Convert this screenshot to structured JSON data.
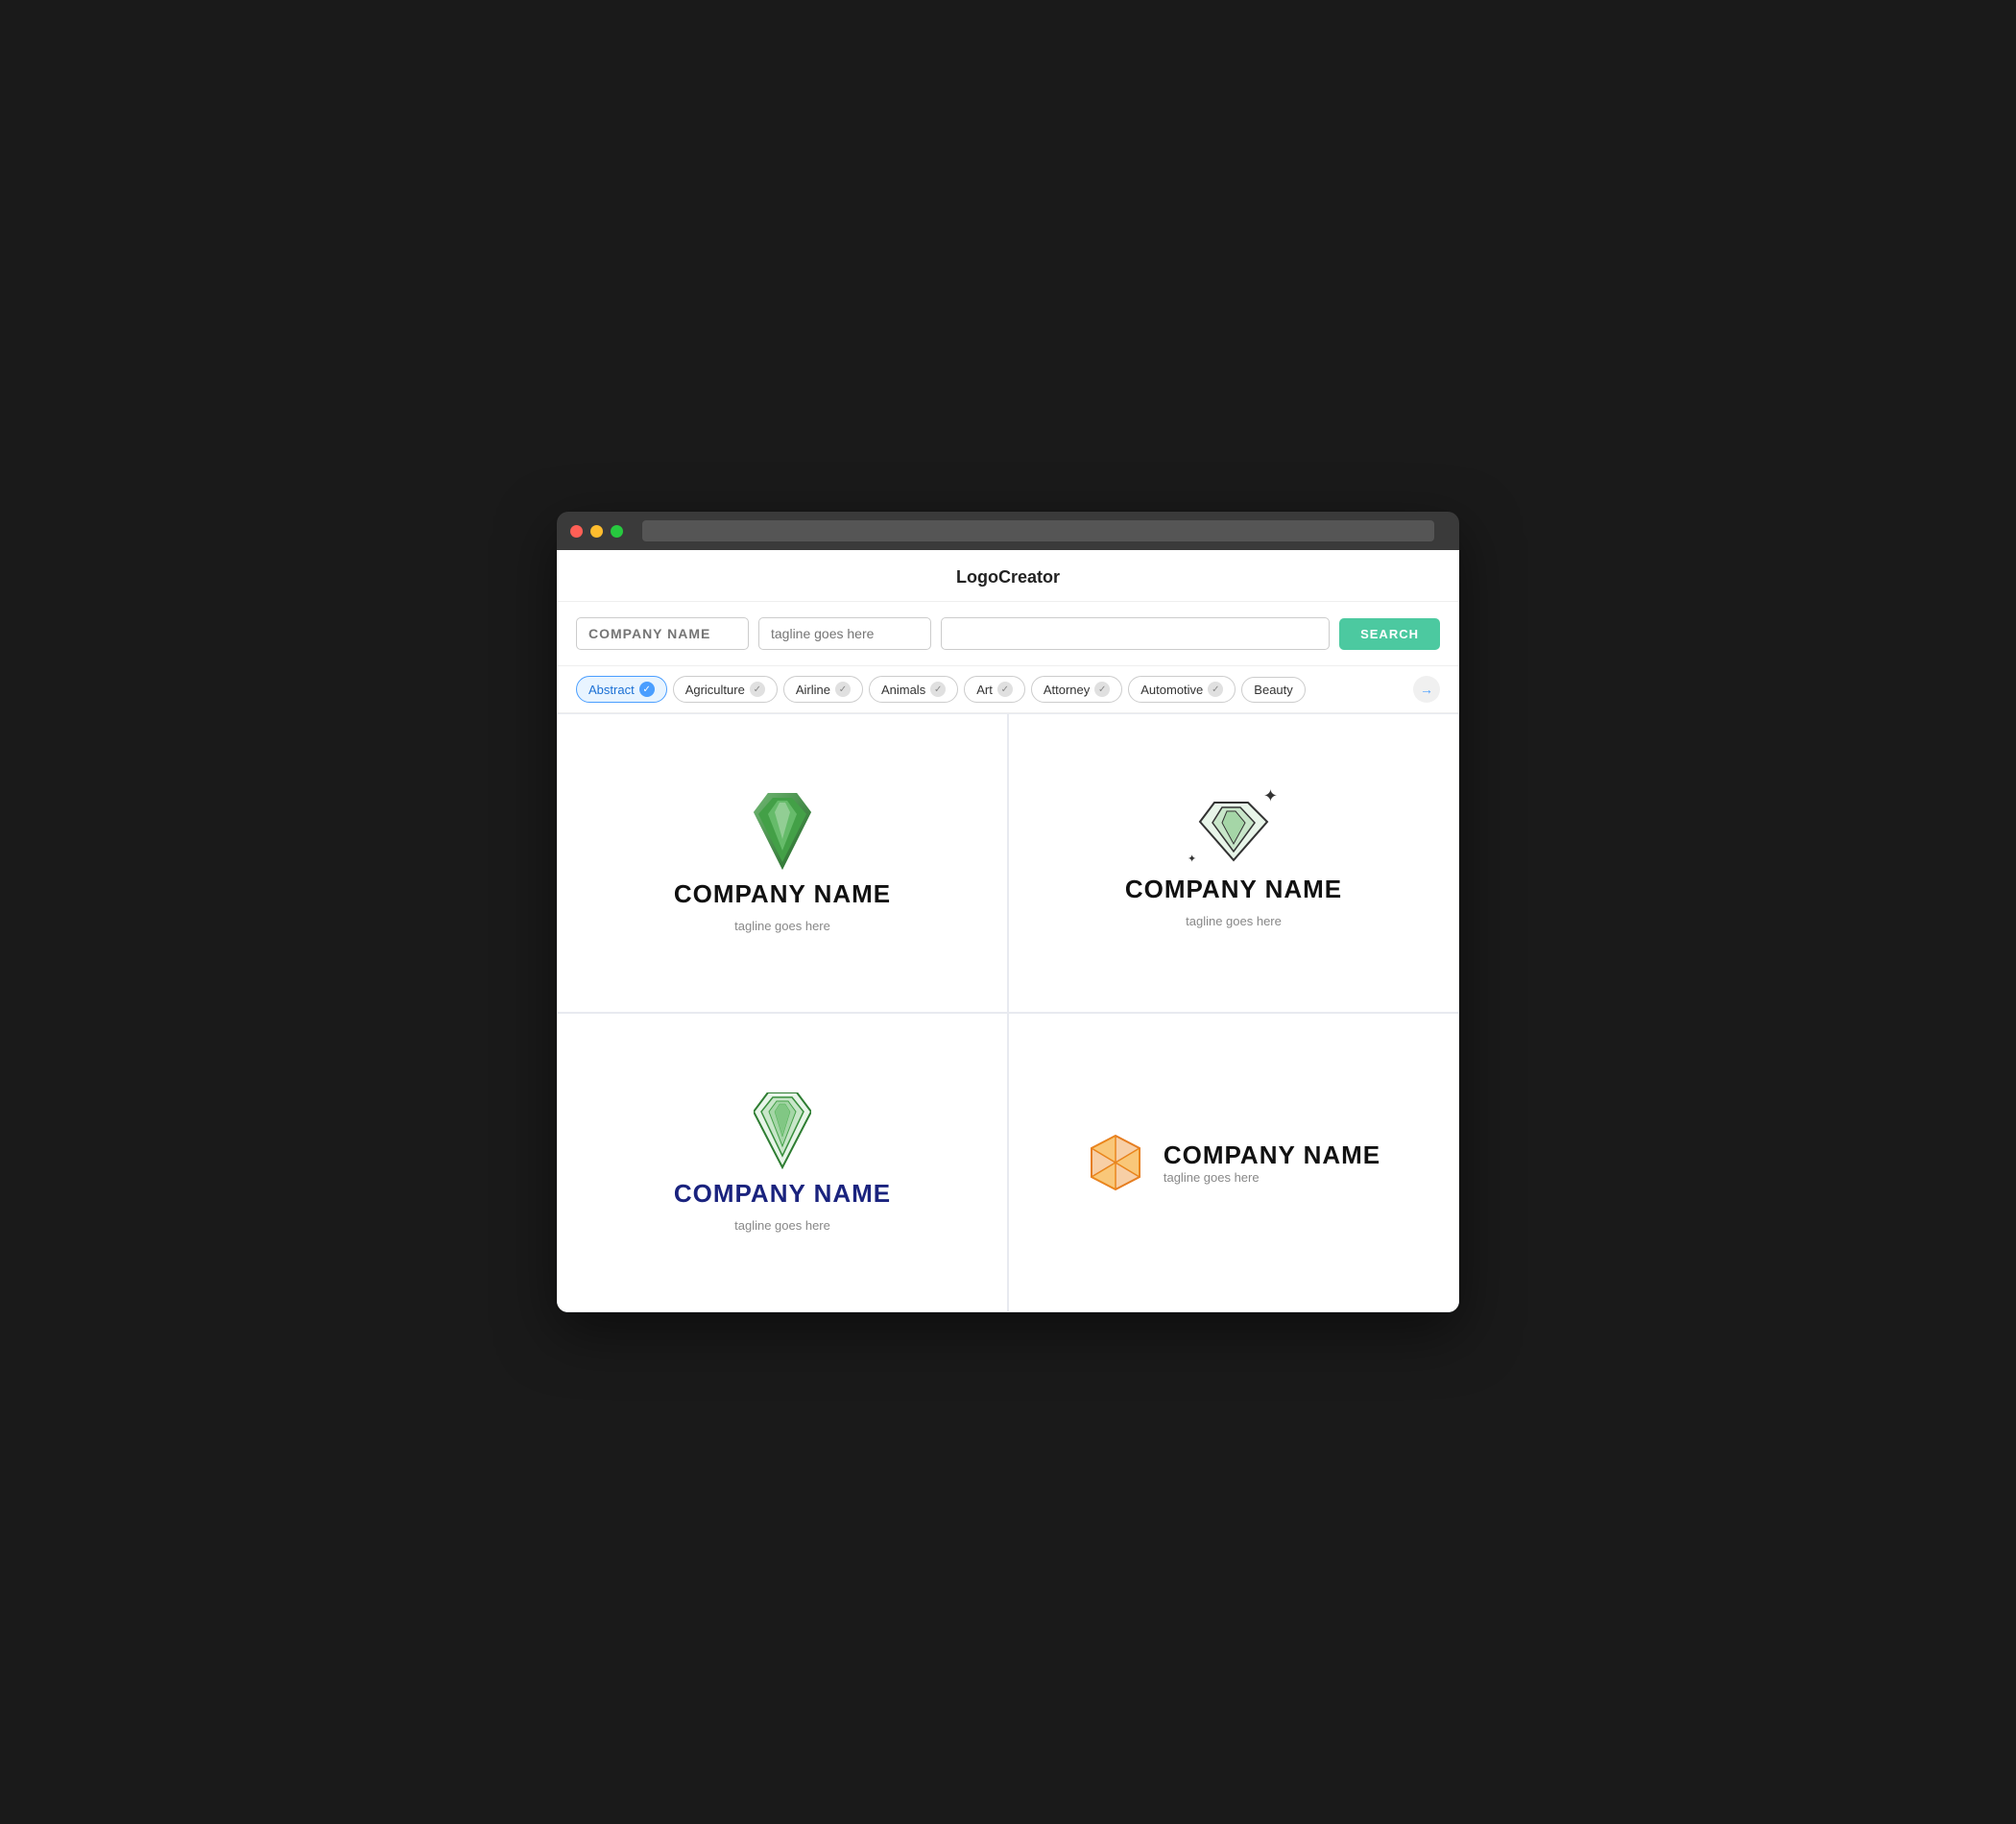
{
  "window": {
    "title": "LogoCreator"
  },
  "search": {
    "company_placeholder": "COMPANY NAME",
    "tagline_placeholder": "tagline goes here",
    "extra_placeholder": "",
    "button_label": "SEARCH"
  },
  "filters": [
    {
      "label": "Abstract",
      "active": true
    },
    {
      "label": "Agriculture",
      "active": false
    },
    {
      "label": "Airline",
      "active": false
    },
    {
      "label": "Animals",
      "active": false
    },
    {
      "label": "Art",
      "active": false
    },
    {
      "label": "Attorney",
      "active": false
    },
    {
      "label": "Automotive",
      "active": false
    },
    {
      "label": "Beauty",
      "active": false
    }
  ],
  "logos": [
    {
      "id": 1,
      "company": "COMPANY NAME",
      "tagline": "tagline goes here",
      "style": "centered",
      "gem": "solid-green",
      "nameColor": "black"
    },
    {
      "id": 2,
      "company": "COMPANY NAME",
      "tagline": "tagline goes here",
      "style": "centered",
      "gem": "outline-green-sparkle",
      "nameColor": "black"
    },
    {
      "id": 3,
      "company": "COMPANY NAME",
      "tagline": "tagline goes here",
      "style": "centered",
      "gem": "outline-green",
      "nameColor": "darkblue"
    },
    {
      "id": 4,
      "company": "COMPANY NAME",
      "tagline": "tagline goes here",
      "style": "horizontal",
      "gem": "polygon-orange",
      "nameColor": "black"
    }
  ]
}
